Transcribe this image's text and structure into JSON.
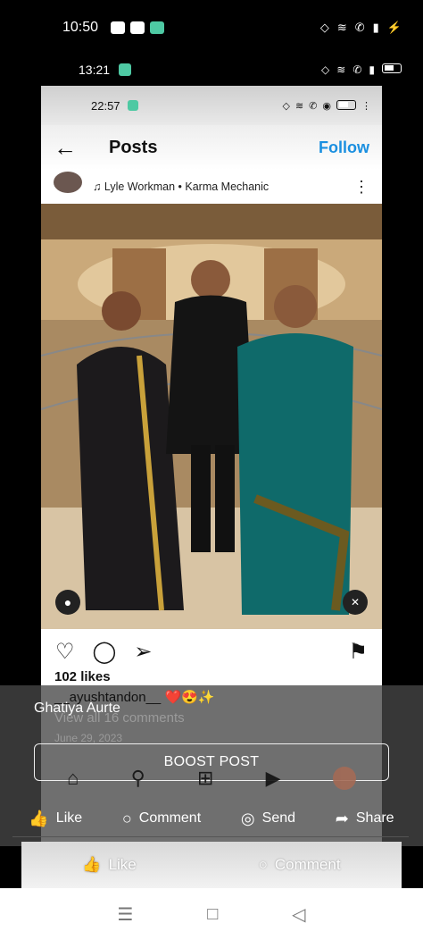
{
  "status_bar": {
    "time": "10:50"
  },
  "status_bar_2": {
    "time": "13:21"
  },
  "inner_status": {
    "time": "22:57"
  },
  "ig_header": {
    "back_icon": "←",
    "title": "Posts",
    "follow": "Follow"
  },
  "post_user": {
    "music_icon": "♫",
    "music": "Lyle Workman • Karma Mechanic",
    "more_icon": "⋮"
  },
  "post": {
    "likes": "102 likes",
    "caption_user": "__ayushtandon__",
    "caption_emojis": "❤️😍✨",
    "view_comments": "View all 16 comments",
    "date": "June 29, 2023"
  },
  "overlay": {
    "author": "Ghatiya Aurte",
    "boost": "BOOST POST"
  },
  "fb_actions": [
    {
      "icon": "👍",
      "label": "Like"
    },
    {
      "icon": "○",
      "label": "Comment"
    },
    {
      "icon": "◎",
      "label": "Send"
    },
    {
      "icon": "➦",
      "label": "Share"
    }
  ],
  "fb_bar2": [
    {
      "icon": "👍",
      "label": "Like"
    },
    {
      "icon": "○",
      "label": "Comment"
    }
  ],
  "sys_nav": {
    "menu": "☰",
    "home": "□",
    "back": "◁"
  }
}
